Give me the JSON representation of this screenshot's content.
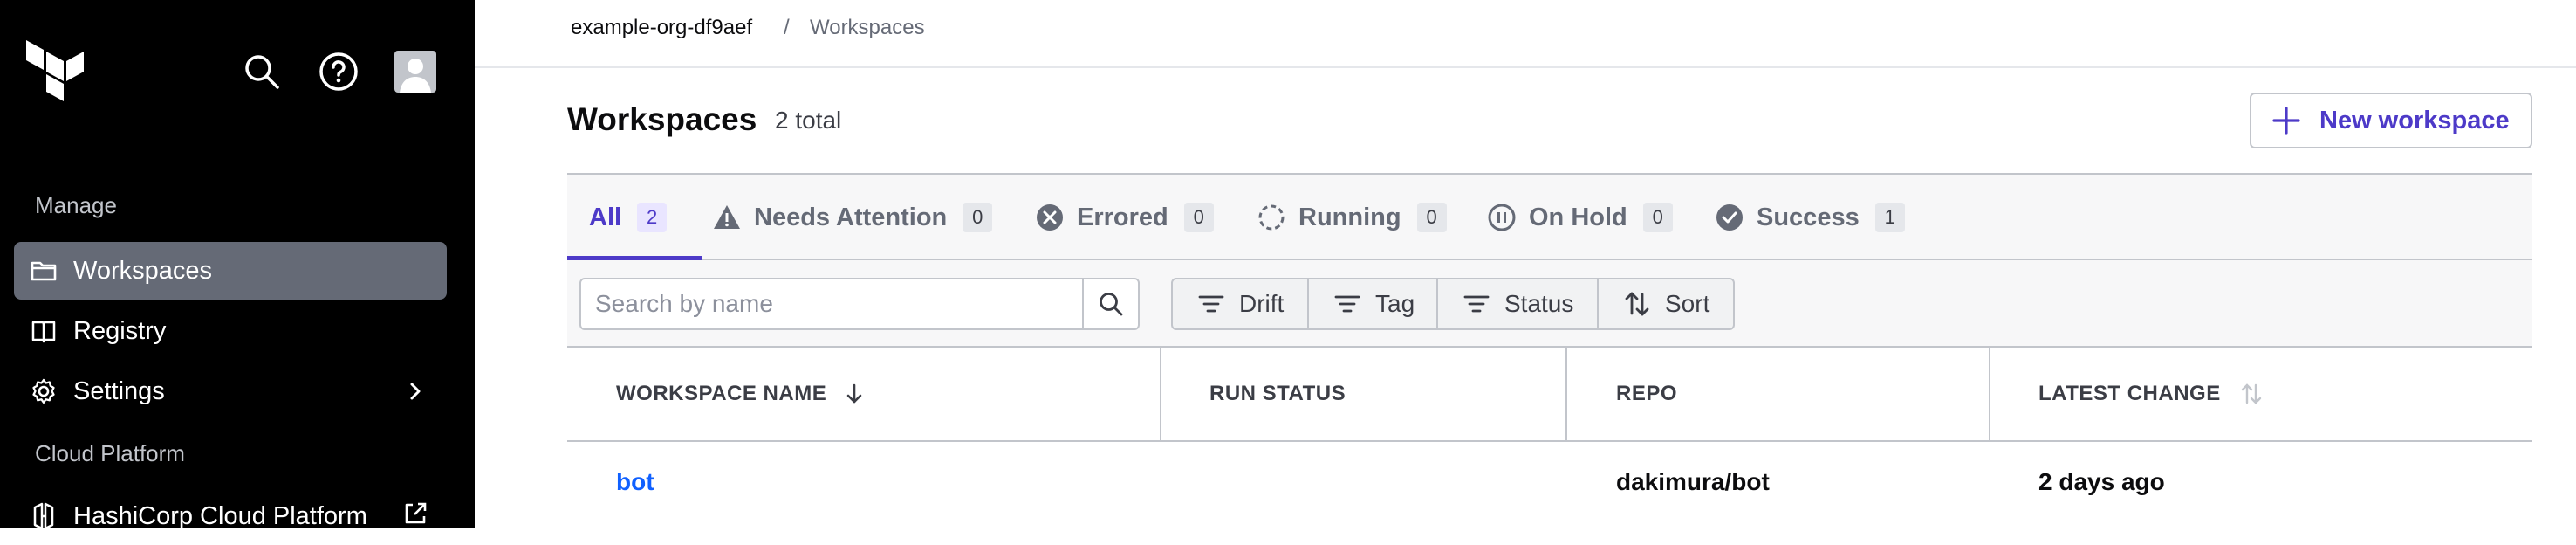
{
  "sidebar": {
    "logo": "terraform-logo",
    "icons": [
      "search-icon",
      "help-icon",
      "avatar-icon"
    ],
    "manage_heading": "Manage",
    "items": [
      {
        "label": "Workspaces",
        "icon": "folder-icon",
        "active": true
      },
      {
        "label": "Registry",
        "icon": "registry-icon"
      },
      {
        "label": "Settings",
        "icon": "gear-icon",
        "chevron": "chevron-right-icon"
      }
    ],
    "cloud_heading": "Cloud Platform",
    "cloud_item": {
      "label": "HashiCorp Cloud Platform",
      "icon": "hashicorp-icon",
      "external": "external-link-icon"
    }
  },
  "breadcrumb": {
    "org": "example-org-df9aef",
    "separator": "/",
    "current": "Workspaces"
  },
  "header": {
    "title": "Workspaces",
    "count": "2 total",
    "new_button": "New workspace"
  },
  "tabs": [
    {
      "label": "All",
      "count": "2",
      "icon": "",
      "active": true
    },
    {
      "label": "Needs Attention",
      "count": "0",
      "icon": "alert-triangle-icon"
    },
    {
      "label": "Errored",
      "count": "0",
      "icon": "x-circle-icon"
    },
    {
      "label": "Running",
      "count": "0",
      "icon": "loading-icon"
    },
    {
      "label": "On Hold",
      "count": "0",
      "icon": "pause-circle-icon"
    },
    {
      "label": "Success",
      "count": "1",
      "icon": "check-circle-icon"
    }
  ],
  "filters": {
    "search_placeholder": "Search by name",
    "buttons": [
      {
        "label": "Drift",
        "icon": "filter-icon"
      },
      {
        "label": "Tag",
        "icon": "filter-icon"
      },
      {
        "label": "Status",
        "icon": "filter-icon"
      },
      {
        "label": "Sort",
        "icon": "swap-vertical-icon"
      }
    ]
  },
  "table": {
    "columns": [
      "WORKSPACE NAME",
      "RUN STATUS",
      "REPO",
      "LATEST CHANGE"
    ],
    "rows": [
      {
        "name": "bot",
        "run_status": "",
        "repo": "dakimura/bot",
        "latest_change": "2 days ago"
      }
    ]
  },
  "colors": {
    "sidebar_bg": "#000000",
    "active_item_bg": "#656a76",
    "accent": "#4d3ac8",
    "link": "#1060ff"
  }
}
